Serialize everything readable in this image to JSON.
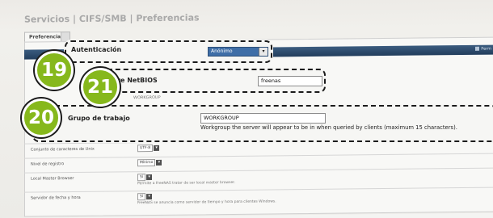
{
  "page": {
    "title": "Servicios | CIFS/SMB | Preferencias",
    "tabs": [
      {
        "label": "Preferencias",
        "active": true
      },
      {
        "label": "",
        "active": false
      }
    ],
    "header_link": "Perm"
  },
  "callouts": {
    "autenticacion": {
      "number": "19",
      "label": "Autenticación",
      "selected": "Anónimo"
    },
    "netbios": {
      "number": "21",
      "label": "Nombre NetBIOS",
      "label_visible": "mbre NetBIOS",
      "value": "freenas"
    },
    "workgroup": {
      "number": "20",
      "label": "Grupo de trabajo",
      "value": "WORKGROUP",
      "description": "Workgroup the server will appear to be in when queried by clients (maximum 15 characters)."
    }
  },
  "background_rows": {
    "ghost_value": "WORKGROUP",
    "rows": [
      {
        "label": "Conjunto de caracteres de Unix",
        "value": "UTF-8",
        "help": ""
      },
      {
        "label": "Nivel de registro",
        "value": "Mínimo",
        "help": ""
      },
      {
        "label": "Local Master Browser",
        "value": "Sí",
        "help": "Permite a FreeNAS tratar de ser local master browser."
      },
      {
        "label": "Servidor de fecha y hora",
        "value": "Sí",
        "help": "FreeNAS se anuncia como servidor de tiempo y hora para clientes Windows."
      }
    ]
  },
  "colors": {
    "badge": "#86b81c",
    "header": "#2b4a6c",
    "dropdown": "#3f6ea7"
  }
}
